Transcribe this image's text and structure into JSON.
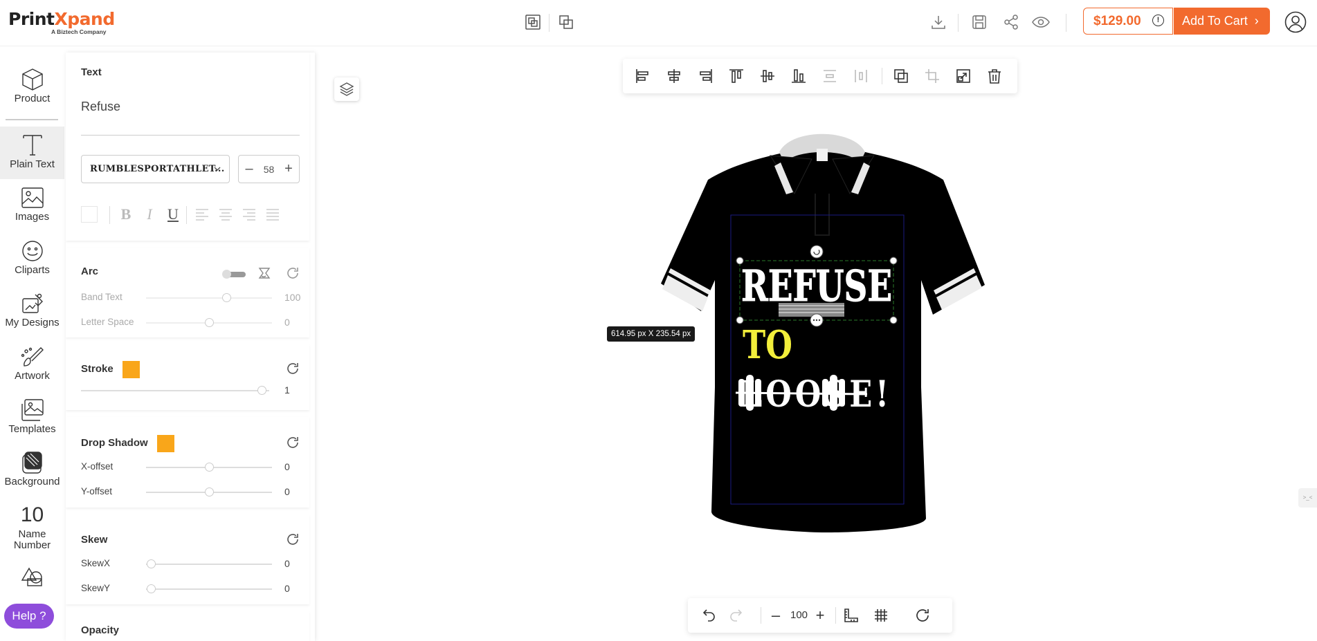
{
  "header": {
    "logo_part1": "Print",
    "logo_part2": "X",
    "logo_part3": "pand",
    "logo_sub": "A Biztech Company",
    "price": "$129.00",
    "add_to_cart": "Add To Cart"
  },
  "leftnav": {
    "items": [
      {
        "label": "Product",
        "icon": "cube-icon"
      },
      {
        "label": "Plain Text",
        "icon": "text-icon"
      },
      {
        "label": "Images",
        "icon": "image-icon"
      },
      {
        "label": "Cliparts",
        "icon": "smiley-icon"
      },
      {
        "label": "My Designs",
        "icon": "designs-icon"
      },
      {
        "label": "Artwork",
        "icon": "brush-icon"
      },
      {
        "label": "Templates",
        "icon": "templates-icon"
      },
      {
        "label": "Background",
        "icon": "background-icon"
      },
      {
        "number": "10",
        "label": "Name Number"
      },
      {
        "label": "",
        "icon": "shapes-icon"
      }
    ],
    "help": "Help ?"
  },
  "panel": {
    "text_section": {
      "title": "Text",
      "value": "Refuse",
      "font": "RUMBLESPORTATHLET...",
      "font_size": "58"
    },
    "arc": {
      "title": "Arc",
      "band_label": "Band Text",
      "band_value": "100",
      "band_level": 0.64,
      "letter_label": "Letter Space",
      "letter_value": "0",
      "letter_level": 0.5
    },
    "stroke": {
      "title": "Stroke",
      "color": "#f9a61a",
      "value": "1",
      "level": 0.96
    },
    "shadow": {
      "title": "Drop Shadow",
      "color": "#f9a61a",
      "x_label": "X-offset",
      "x_value": "0",
      "x_level": 0.5,
      "y_label": "Y-offset",
      "y_value": "0",
      "y_level": 0.5
    },
    "skew": {
      "title": "Skew",
      "x_label": "SkewX",
      "x_value": "0",
      "x_level": 0.04,
      "y_label": "SkewY",
      "y_value": "0",
      "y_level": 0.04
    },
    "opacity": {
      "title": "Opacity"
    }
  },
  "canvas": {
    "dimension_label": "614.95 px X 235.54 px",
    "design_line1": "REFUSE",
    "design_line2": "TO",
    "design_line3": "LOOSE!",
    "zoom": "100",
    "edge_tab": ">_<"
  },
  "colors": {
    "brand": "#f26a2e",
    "help": "#8e4ddb",
    "shirt": "#000000",
    "yellow_text": "#f2ee3b"
  }
}
